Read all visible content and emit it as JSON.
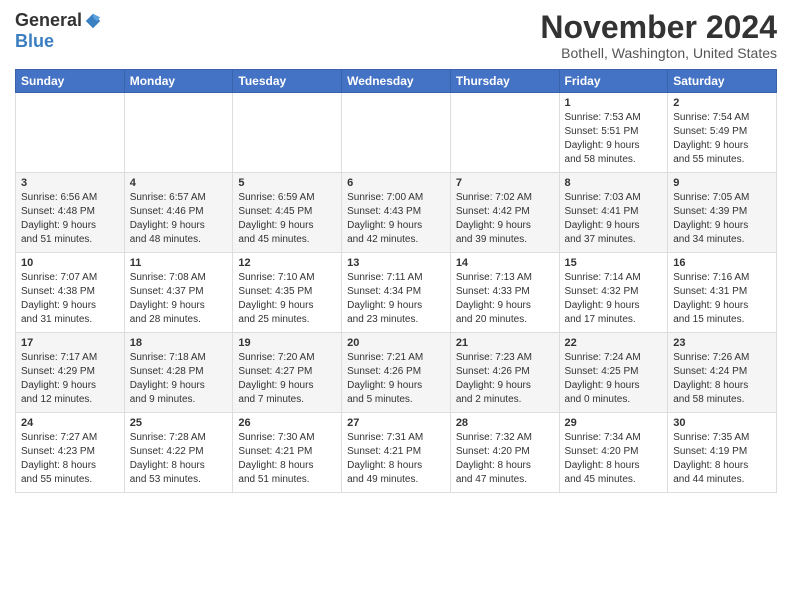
{
  "logo": {
    "general": "General",
    "blue": "Blue"
  },
  "title": "November 2024",
  "location": "Bothell, Washington, United States",
  "days_header": [
    "Sunday",
    "Monday",
    "Tuesday",
    "Wednesday",
    "Thursday",
    "Friday",
    "Saturday"
  ],
  "weeks": [
    [
      {
        "day": "",
        "info": ""
      },
      {
        "day": "",
        "info": ""
      },
      {
        "day": "",
        "info": ""
      },
      {
        "day": "",
        "info": ""
      },
      {
        "day": "",
        "info": ""
      },
      {
        "day": "1",
        "info": "Sunrise: 7:53 AM\nSunset: 5:51 PM\nDaylight: 9 hours\nand 58 minutes."
      },
      {
        "day": "2",
        "info": "Sunrise: 7:54 AM\nSunset: 5:49 PM\nDaylight: 9 hours\nand 55 minutes."
      }
    ],
    [
      {
        "day": "3",
        "info": "Sunrise: 6:56 AM\nSunset: 4:48 PM\nDaylight: 9 hours\nand 51 minutes."
      },
      {
        "day": "4",
        "info": "Sunrise: 6:57 AM\nSunset: 4:46 PM\nDaylight: 9 hours\nand 48 minutes."
      },
      {
        "day": "5",
        "info": "Sunrise: 6:59 AM\nSunset: 4:45 PM\nDaylight: 9 hours\nand 45 minutes."
      },
      {
        "day": "6",
        "info": "Sunrise: 7:00 AM\nSunset: 4:43 PM\nDaylight: 9 hours\nand 42 minutes."
      },
      {
        "day": "7",
        "info": "Sunrise: 7:02 AM\nSunset: 4:42 PM\nDaylight: 9 hours\nand 39 minutes."
      },
      {
        "day": "8",
        "info": "Sunrise: 7:03 AM\nSunset: 4:41 PM\nDaylight: 9 hours\nand 37 minutes."
      },
      {
        "day": "9",
        "info": "Sunrise: 7:05 AM\nSunset: 4:39 PM\nDaylight: 9 hours\nand 34 minutes."
      }
    ],
    [
      {
        "day": "10",
        "info": "Sunrise: 7:07 AM\nSunset: 4:38 PM\nDaylight: 9 hours\nand 31 minutes."
      },
      {
        "day": "11",
        "info": "Sunrise: 7:08 AM\nSunset: 4:37 PM\nDaylight: 9 hours\nand 28 minutes."
      },
      {
        "day": "12",
        "info": "Sunrise: 7:10 AM\nSunset: 4:35 PM\nDaylight: 9 hours\nand 25 minutes."
      },
      {
        "day": "13",
        "info": "Sunrise: 7:11 AM\nSunset: 4:34 PM\nDaylight: 9 hours\nand 23 minutes."
      },
      {
        "day": "14",
        "info": "Sunrise: 7:13 AM\nSunset: 4:33 PM\nDaylight: 9 hours\nand 20 minutes."
      },
      {
        "day": "15",
        "info": "Sunrise: 7:14 AM\nSunset: 4:32 PM\nDaylight: 9 hours\nand 17 minutes."
      },
      {
        "day": "16",
        "info": "Sunrise: 7:16 AM\nSunset: 4:31 PM\nDaylight: 9 hours\nand 15 minutes."
      }
    ],
    [
      {
        "day": "17",
        "info": "Sunrise: 7:17 AM\nSunset: 4:29 PM\nDaylight: 9 hours\nand 12 minutes."
      },
      {
        "day": "18",
        "info": "Sunrise: 7:18 AM\nSunset: 4:28 PM\nDaylight: 9 hours\nand 9 minutes."
      },
      {
        "day": "19",
        "info": "Sunrise: 7:20 AM\nSunset: 4:27 PM\nDaylight: 9 hours\nand 7 minutes."
      },
      {
        "day": "20",
        "info": "Sunrise: 7:21 AM\nSunset: 4:26 PM\nDaylight: 9 hours\nand 5 minutes."
      },
      {
        "day": "21",
        "info": "Sunrise: 7:23 AM\nSunset: 4:26 PM\nDaylight: 9 hours\nand 2 minutes."
      },
      {
        "day": "22",
        "info": "Sunrise: 7:24 AM\nSunset: 4:25 PM\nDaylight: 9 hours\nand 0 minutes."
      },
      {
        "day": "23",
        "info": "Sunrise: 7:26 AM\nSunset: 4:24 PM\nDaylight: 8 hours\nand 58 minutes."
      }
    ],
    [
      {
        "day": "24",
        "info": "Sunrise: 7:27 AM\nSunset: 4:23 PM\nDaylight: 8 hours\nand 55 minutes."
      },
      {
        "day": "25",
        "info": "Sunrise: 7:28 AM\nSunset: 4:22 PM\nDaylight: 8 hours\nand 53 minutes."
      },
      {
        "day": "26",
        "info": "Sunrise: 7:30 AM\nSunset: 4:21 PM\nDaylight: 8 hours\nand 51 minutes."
      },
      {
        "day": "27",
        "info": "Sunrise: 7:31 AM\nSunset: 4:21 PM\nDaylight: 8 hours\nand 49 minutes."
      },
      {
        "day": "28",
        "info": "Sunrise: 7:32 AM\nSunset: 4:20 PM\nDaylight: 8 hours\nand 47 minutes."
      },
      {
        "day": "29",
        "info": "Sunrise: 7:34 AM\nSunset: 4:20 PM\nDaylight: 8 hours\nand 45 minutes."
      },
      {
        "day": "30",
        "info": "Sunrise: 7:35 AM\nSunset: 4:19 PM\nDaylight: 8 hours\nand 44 minutes."
      }
    ]
  ]
}
